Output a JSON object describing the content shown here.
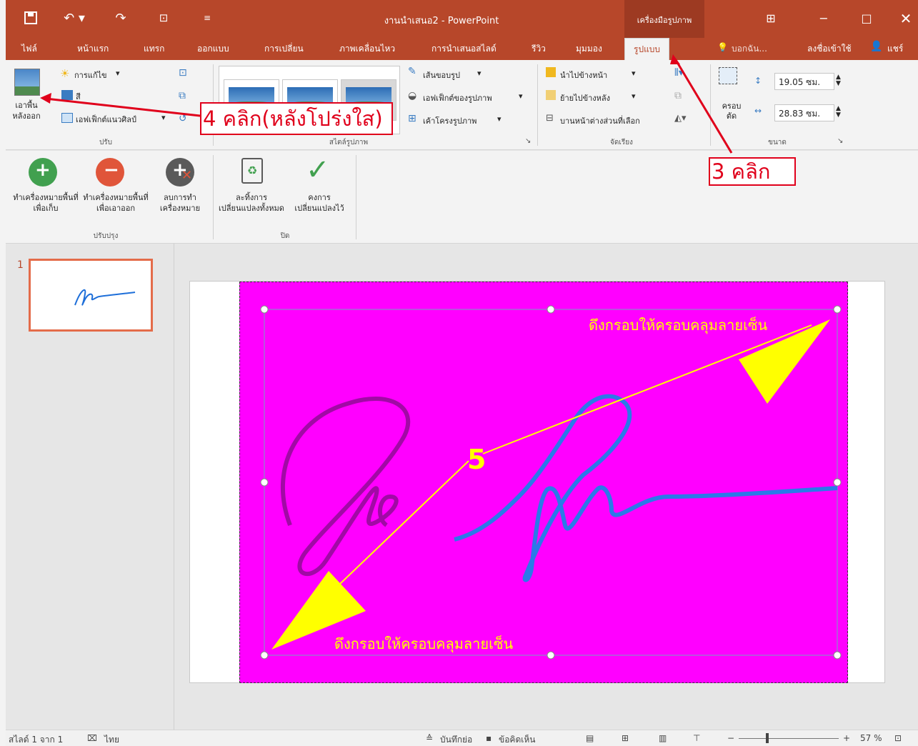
{
  "titlebar": {
    "title": "งานนำเสนอ2 - PowerPoint",
    "context_group": "เครื่องมือรูปภาพ",
    "icons": [
      "save-icon",
      "undo-icon",
      "redo-icon",
      "present-icon",
      "customize-icon",
      "ribbon-display-icon",
      "minimize-icon",
      "maximize-icon",
      "close-icon"
    ]
  },
  "tabs": {
    "file": "ไฟล์",
    "home": "หน้าแรก",
    "insert": "แทรก",
    "design": "ออกแบบ",
    "transitions": "การเปลี่ยน",
    "animations": "ภาพเคลื่อนไหว",
    "slideshow": "การนำเสนอสไลด์",
    "review": "รีวิว",
    "view": "มุมมอง",
    "format": "รูปแบบ",
    "tellme": "บอกฉัน...",
    "signin": "ลงชื่อเข้าใช้",
    "share": "แชร์"
  },
  "ribbon": {
    "remove_bg": "เอาพื้นหลังออก",
    "corrections": "การแก้ไข",
    "color": "สี",
    "artistic": "เอฟเฟ็กต์แนวศิลป์",
    "adjust_group": "ปรับ",
    "styles_group": "สไตล์รูปภาพ",
    "border": "เส้นขอบรูป",
    "effects": "เอฟเฟ็กต์ของรูปภาพ",
    "layout": "เค้าโครงรูปภาพ",
    "bring_forward": "นำไปข้างหน้า",
    "send_backward": "ย้ายไปข้างหลัง",
    "selection_pane": "บานหน้าต่างส่วนที่เลือก",
    "arrange_group": "จัดเรียง",
    "crop": "ครอบตัด",
    "height": "19.05 ซม.",
    "width": "28.83 ซม.",
    "size_group": "ขนาด"
  },
  "bg_removal": {
    "mark_keep": "ทำเครื่องหมายพื้นที่เพื่อเก็บ",
    "mark_remove": "ทำเครื่องหมายพื้นที่เพื่อเอาออก",
    "delete_mark": "ลบการทำเครื่องหมาย",
    "refine_group": "ปรับปรุง",
    "discard": "ละทิ้งการเปลี่ยนแปลงทั้งหมด",
    "keep": "คงการเปลี่ยนแปลงไว้",
    "close_group": "ปิด"
  },
  "slides": {
    "number": "1"
  },
  "annotations": {
    "step3": "3 คลิก",
    "step4": "4 คลิก(หลังโปร่งใส)",
    "step5": "5",
    "drag_top": "ดึงกรอบให้ครอบคลุมลายเซ็น",
    "drag_bottom": "ดึงกรอบให้ครอบคลุมลายเซ็น"
  },
  "status": {
    "slide_of": "สไลด์ 1 จาก 1",
    "language": "ไทย",
    "notes": "บันทึกย่อ",
    "comments": "ข้อคิดเห็น",
    "zoom": "57 %"
  },
  "colors": {
    "accent": "#b7472a",
    "picture_bg": "#ff00ff",
    "callout": "#e0001b",
    "arrow": "#ffff00"
  }
}
